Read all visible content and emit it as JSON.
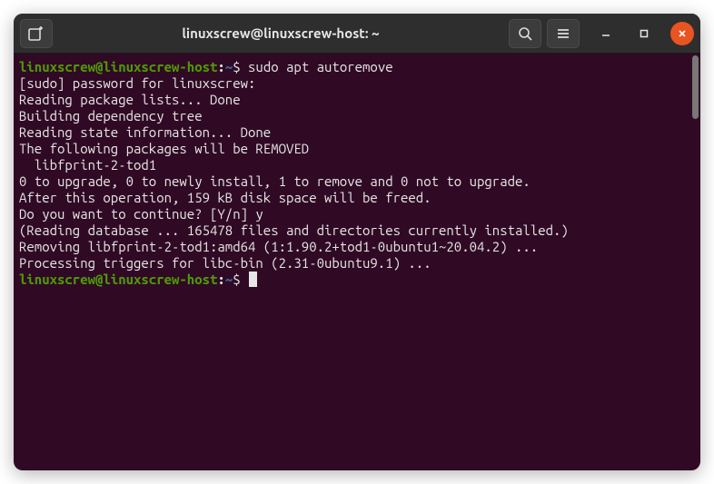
{
  "titlebar": {
    "title": "linuxscrew@linuxscrew-host: ~"
  },
  "prompt": {
    "user_host": "linuxscrew@linuxscrew-host",
    "path": "~",
    "symbol": "$"
  },
  "session": {
    "command1": "sudo apt autoremove",
    "lines": [
      "[sudo] password for linuxscrew:",
      "Reading package lists... Done",
      "Building dependency tree",
      "Reading state information... Done",
      "The following packages will be REMOVED",
      "  libfprint-2-tod1",
      "0 to upgrade, 0 to newly install, 1 to remove and 0 not to upgrade.",
      "After this operation, 159 kB disk space will be freed.",
      "Do you want to continue? [Y/n] y",
      "(Reading database ... 165478 files and directories currently installed.)",
      "Removing libfprint-2-tod1:amd64 (1:1.90.2+tod1-0ubuntu1~20.04.2) ...",
      "Processing triggers for libc-bin (2.31-0ubuntu9.1) ..."
    ]
  }
}
